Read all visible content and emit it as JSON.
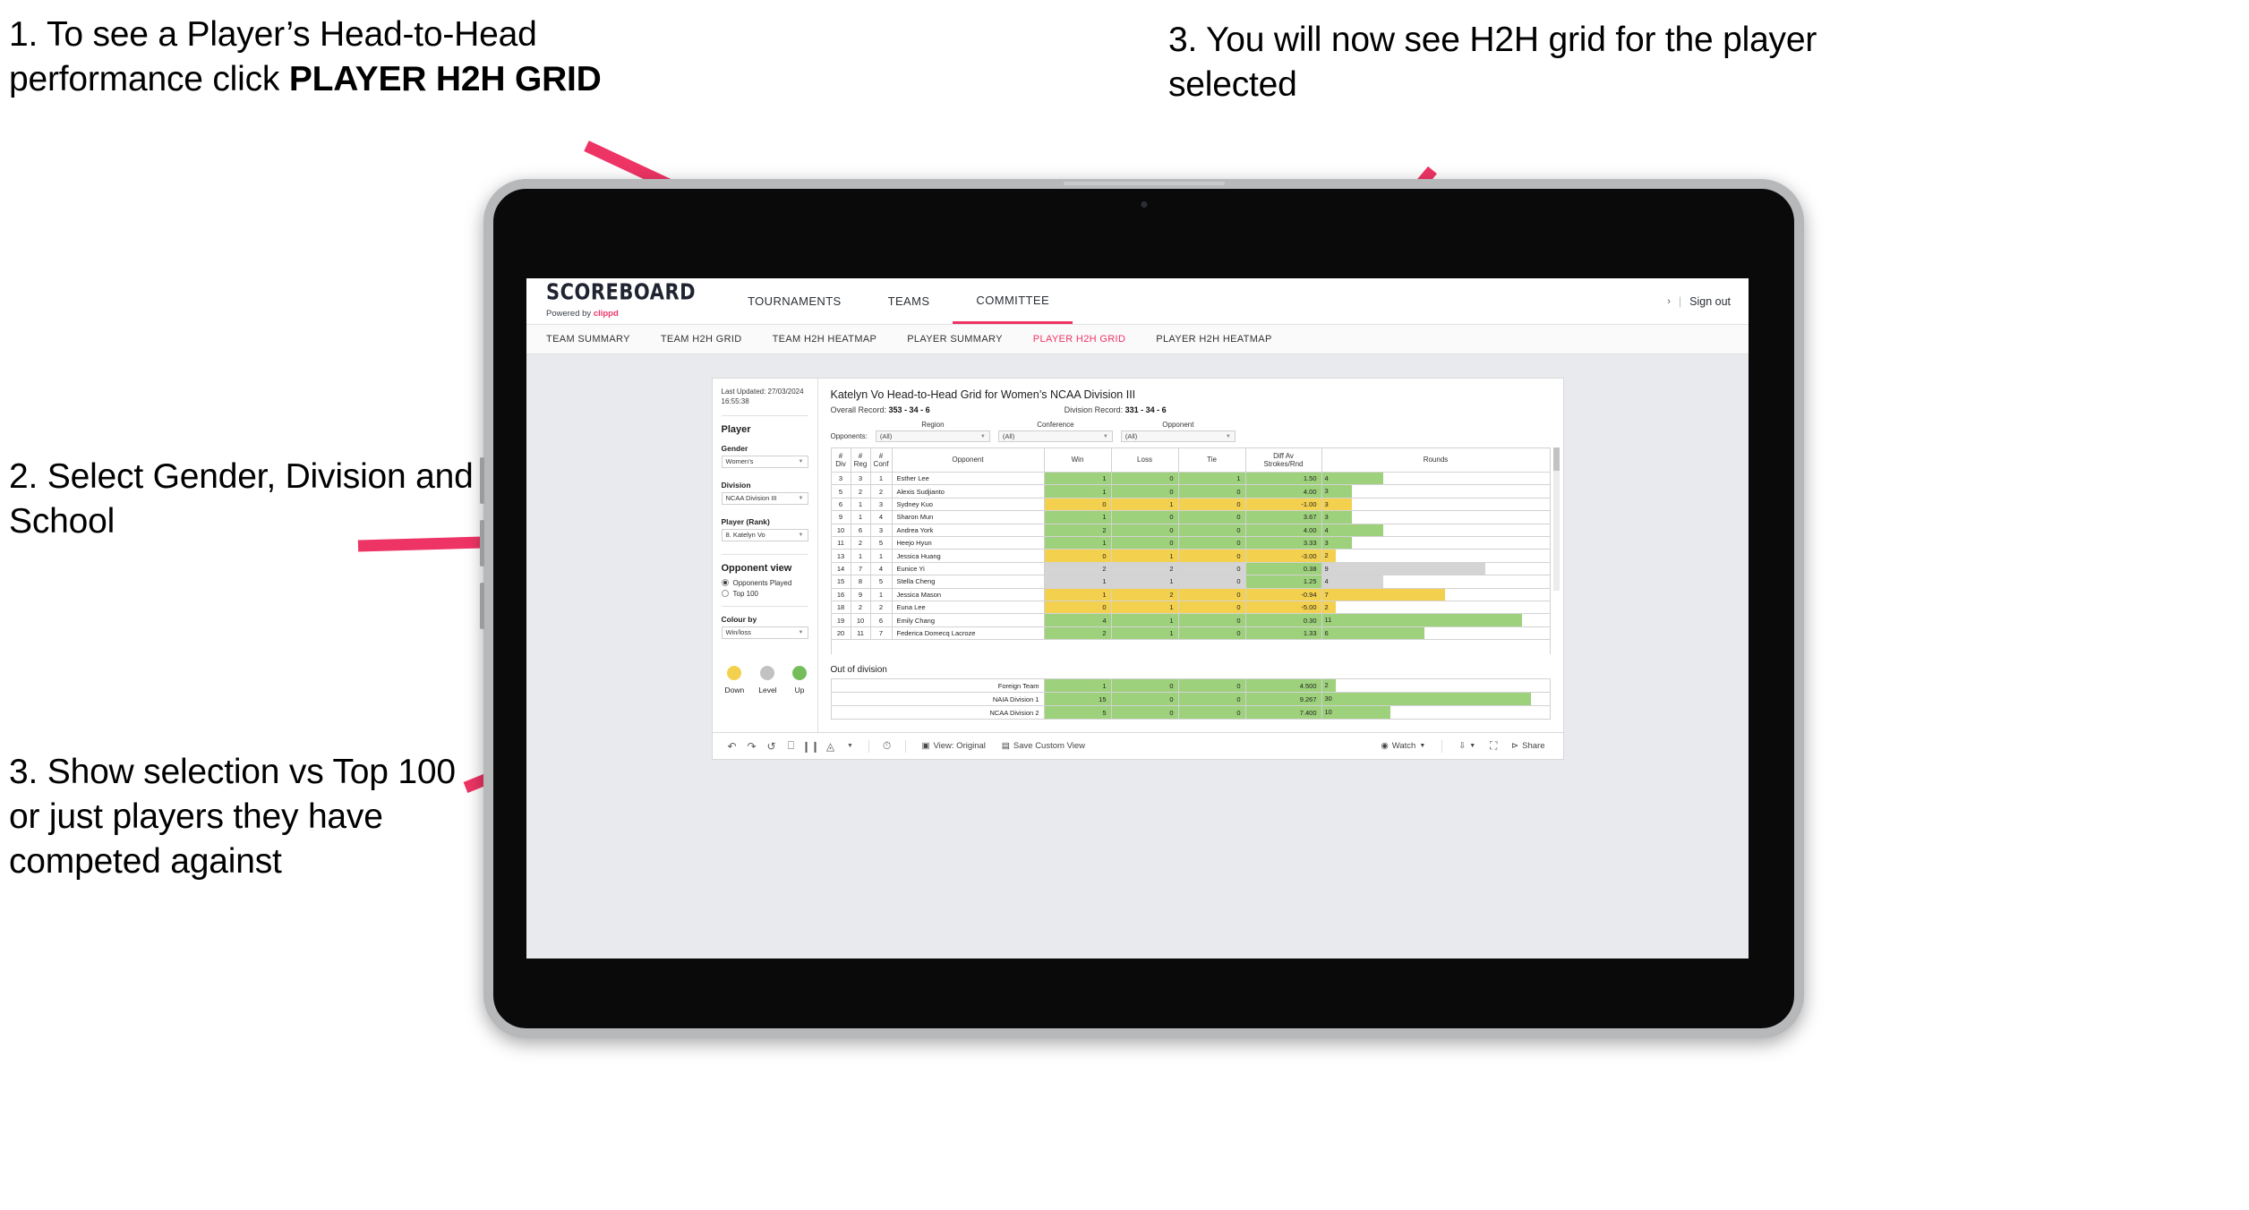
{
  "annotations": [
    {
      "id": "anno-1",
      "pre": "1. To see a Player’s Head-to-Head performance click ",
      "bold": "PLAYER H2H GRID"
    },
    {
      "id": "anno-2",
      "text": "2. Select Gender, Division and School"
    },
    {
      "id": "anno-3",
      "text": "3. Show selection vs Top 100 or just players they have competed against"
    },
    {
      "id": "anno-4",
      "text": "3. You will now see H2H grid for the player selected"
    }
  ],
  "brand": {
    "logo": "SCOREBOARD",
    "powered_by": "Powered by",
    "clippd": "clippd"
  },
  "mainnav": [
    {
      "label": "TOURNAMENTS",
      "active": false
    },
    {
      "label": "TEAMS",
      "active": false
    },
    {
      "label": "COMMITTEE",
      "active": true
    }
  ],
  "header_right": {
    "chevron": "›",
    "sep": "|",
    "sign_out": "Sign out"
  },
  "subnav": [
    {
      "label": "TEAM SUMMARY",
      "active": false
    },
    {
      "label": "TEAM H2H GRID",
      "active": false
    },
    {
      "label": "TEAM H2H HEATMAP",
      "active": false
    },
    {
      "label": "PLAYER SUMMARY",
      "active": false
    },
    {
      "label": "PLAYER H2H GRID",
      "active": true
    },
    {
      "label": "PLAYER H2H HEATMAP",
      "active": false
    }
  ],
  "filters": {
    "last_updated": "Last Updated: 27/03/2024 16:55:38",
    "player_heading": "Player",
    "gender": {
      "label": "Gender",
      "value": "Women's"
    },
    "division": {
      "label": "Division",
      "value": "NCAA Division III"
    },
    "player_rank": {
      "label": "Player (Rank)",
      "value": "8. Katelyn Vo"
    },
    "opponent_view": {
      "heading": "Opponent view",
      "options": [
        {
          "label": "Opponents Played",
          "selected": true
        },
        {
          "label": "Top 100",
          "selected": false
        }
      ]
    },
    "colour_by": {
      "label": "Colour by",
      "value": "Win/loss"
    },
    "legend": [
      {
        "label": "Down",
        "color": "#f3d04e"
      },
      {
        "label": "Level",
        "color": "#c2c2c2"
      },
      {
        "label": "Up",
        "color": "#74bd5a"
      }
    ]
  },
  "viz": {
    "title": "Katelyn Vo Head-to-Head Grid for Women’s NCAA Division III",
    "overall_record_label": "Overall Record:",
    "overall_record": "353 -  34 - 6",
    "division_record_label": "Division Record:",
    "division_record": "331 -  34 - 6",
    "opponents_label": "Opponents:",
    "opponent_filters": [
      {
        "caption": "Region",
        "value": "(All)"
      },
      {
        "caption": "Conference",
        "value": "(All)"
      },
      {
        "caption": "Opponent",
        "value": "(All)"
      }
    ],
    "columns": [
      {
        "l1": "#",
        "l2": "Div"
      },
      {
        "l1": "#",
        "l2": "Reg"
      },
      {
        "l1": "#",
        "l2": "Conf"
      },
      {
        "l1": "Opponent",
        "l2": ""
      },
      {
        "l1": "Win",
        "l2": ""
      },
      {
        "l1": "Loss",
        "l2": ""
      },
      {
        "l1": "Tie",
        "l2": ""
      },
      {
        "l1": "Diff Av",
        "l2": "Strokes/Rnd"
      },
      {
        "l1": "Rounds",
        "l2": ""
      }
    ],
    "rows": [
      {
        "div": "3",
        "reg": "3",
        "conf": "1",
        "opponent": "Esther Lee",
        "win": "1",
        "loss": "0",
        "tie": "1",
        "diff": "1.50",
        "rounds": "4",
        "color": "green",
        "bar_pct": 27
      },
      {
        "div": "5",
        "reg": "2",
        "conf": "2",
        "opponent": "Alexis Sudjianto",
        "win": "1",
        "loss": "0",
        "tie": "0",
        "diff": "4.00",
        "rounds": "3",
        "color": "green",
        "bar_pct": 13
      },
      {
        "div": "6",
        "reg": "1",
        "conf": "3",
        "opponent": "Sydney Kuo",
        "win": "0",
        "loss": "1",
        "tie": "0",
        "diff": "-1.00",
        "rounds": "3",
        "color": "yellow",
        "bar_pct": 13
      },
      {
        "div": "9",
        "reg": "1",
        "conf": "4",
        "opponent": "Sharon Mun",
        "win": "1",
        "loss": "0",
        "tie": "0",
        "diff": "3.67",
        "rounds": "3",
        "color": "green",
        "bar_pct": 13
      },
      {
        "div": "10",
        "reg": "6",
        "conf": "3",
        "opponent": "Andrea York",
        "win": "2",
        "loss": "0",
        "tie": "0",
        "diff": "4.00",
        "rounds": "4",
        "color": "green",
        "bar_pct": 27
      },
      {
        "div": "11",
        "reg": "2",
        "conf": "5",
        "opponent": "Heejo Hyun",
        "win": "1",
        "loss": "0",
        "tie": "0",
        "diff": "3.33",
        "rounds": "3",
        "color": "green",
        "bar_pct": 13
      },
      {
        "div": "13",
        "reg": "1",
        "conf": "1",
        "opponent": "Jessica Huang",
        "win": "0",
        "loss": "1",
        "tie": "0",
        "diff": "-3.00",
        "rounds": "2",
        "color": "yellow",
        "bar_pct": 6
      },
      {
        "div": "14",
        "reg": "7",
        "conf": "4",
        "opponent": "Eunice Yi",
        "win": "2",
        "loss": "2",
        "tie": "0",
        "diff": "0.38",
        "rounds": "9",
        "color": "grey",
        "bar_pct": 72
      },
      {
        "div": "15",
        "reg": "8",
        "conf": "5",
        "opponent": "Stella Cheng",
        "win": "1",
        "loss": "1",
        "tie": "0",
        "diff": "1.25",
        "rounds": "4",
        "color": "grey",
        "bar_pct": 27
      },
      {
        "div": "16",
        "reg": "9",
        "conf": "1",
        "opponent": "Jessica Mason",
        "win": "1",
        "loss": "2",
        "tie": "0",
        "diff": "-0.94",
        "rounds": "7",
        "color": "yellow",
        "bar_pct": 54
      },
      {
        "div": "18",
        "reg": "2",
        "conf": "2",
        "opponent": "Euna Lee",
        "win": "0",
        "loss": "1",
        "tie": "0",
        "diff": "-5.00",
        "rounds": "2",
        "color": "yellow",
        "bar_pct": 6
      },
      {
        "div": "19",
        "reg": "10",
        "conf": "6",
        "opponent": "Emily Chang",
        "win": "4",
        "loss": "1",
        "tie": "0",
        "diff": "0.30",
        "rounds": "11",
        "color": "green",
        "bar_pct": 88
      },
      {
        "div": "20",
        "reg": "11",
        "conf": "7",
        "opponent": "Federica Domecq Lacroze",
        "win": "2",
        "loss": "1",
        "tie": "0",
        "diff": "1.33",
        "rounds": "6",
        "color": "green",
        "bar_pct": 45
      }
    ],
    "out_of_division": {
      "title": "Out of division",
      "rows": [
        {
          "name": "Foreign Team",
          "win": "1",
          "loss": "0",
          "tie": "0",
          "diff": "4.500",
          "rounds": "2",
          "color": "green",
          "bar_pct": 6
        },
        {
          "name": "NAIA Division 1",
          "win": "15",
          "loss": "0",
          "tie": "0",
          "diff": "9.267",
          "rounds": "30",
          "color": "green",
          "bar_pct": 92
        },
        {
          "name": "NCAA Division 2",
          "win": "5",
          "loss": "0",
          "tie": "0",
          "diff": "7.400",
          "rounds": "10",
          "color": "green",
          "bar_pct": 30
        }
      ]
    }
  },
  "toolbar": {
    "view_original": "View: Original",
    "save_custom_view": "Save Custom View",
    "watch": "Watch",
    "share": "Share",
    "caret": "▾"
  },
  "colors": {
    "accent": "#ee3465",
    "green": "#9ed17c",
    "yellow": "#f3d04e",
    "grey": "#d4d4d4"
  }
}
